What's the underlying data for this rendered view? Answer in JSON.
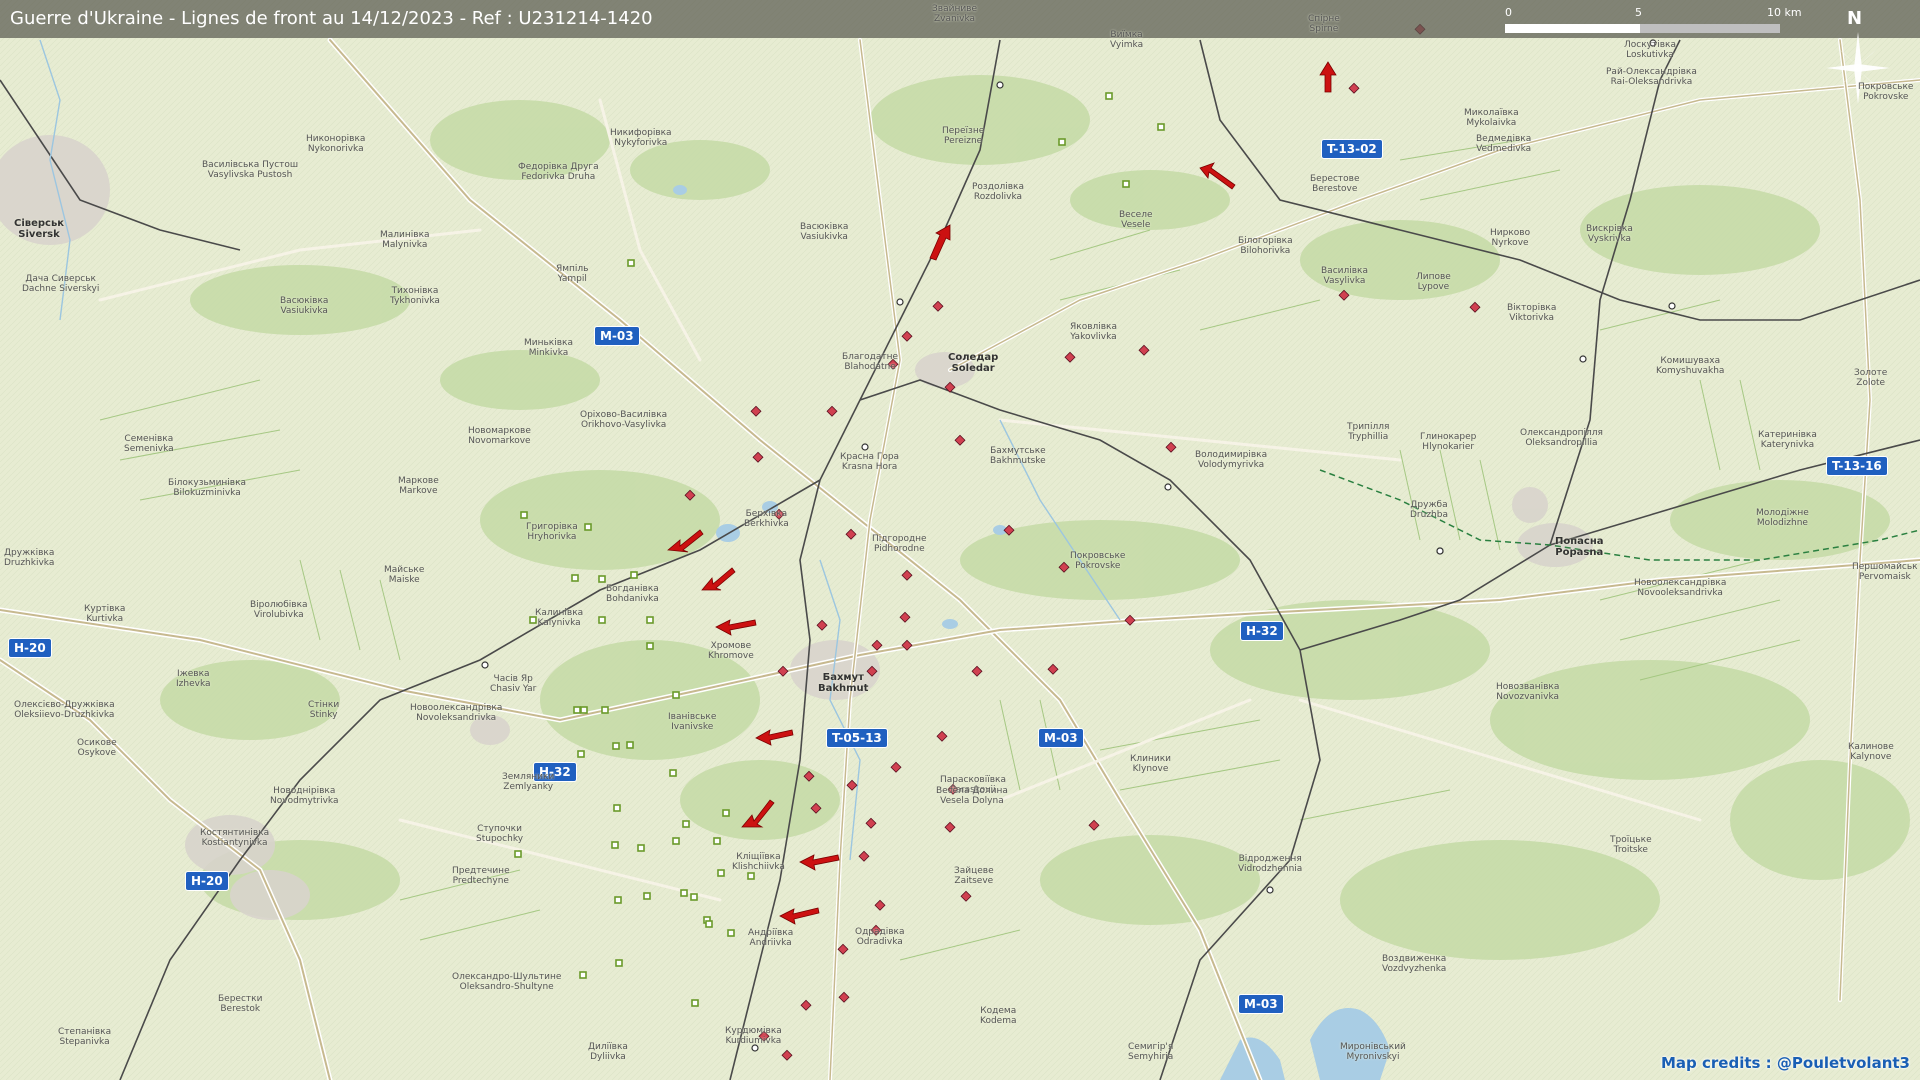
{
  "title": "Guerre d'Ukraine - Lignes de front au 14/12/2023 - Ref : U231214-1420",
  "scale": {
    "labels": [
      "0",
      "5",
      "10 km"
    ]
  },
  "north": {
    "letter": "N",
    "icon": "compass-rose-icon"
  },
  "credits": "Map credits : @Pouletvolant3",
  "colors": {
    "background": "#e7ecd2",
    "road_shield": "#2060c0",
    "attack_arrow": "#cc1111",
    "unit_marker": "#d04050",
    "friendly_marker": "#7aa83a",
    "railway": "#4a4a4a",
    "frontline": "#2a8040"
  },
  "road_shields": [
    {
      "label": "M-03"
    },
    {
      "label": "T-13-02"
    },
    {
      "label": "H-20"
    },
    {
      "label": "H-20"
    },
    {
      "label": "T-05-13"
    },
    {
      "label": "M-03"
    },
    {
      "label": "H-32"
    },
    {
      "label": "H-32"
    },
    {
      "label": "T-13-16"
    },
    {
      "label": "M-03"
    }
  ],
  "places": [
    {
      "ua": "Бахмут",
      "lat": "Bakhmut",
      "major": true
    },
    {
      "ua": "Соледар",
      "lat": "Soledar",
      "major": true
    },
    {
      "ua": "Часів Яр",
      "lat": "Chasiv Yar",
      "major": false
    },
    {
      "ua": "Благодатне",
      "lat": "Blahodatne"
    },
    {
      "ua": "Красна Гора",
      "lat": "Krasna Hora"
    },
    {
      "ua": "Парасковіївка",
      "lat": "Paraskovii"
    },
    {
      "ua": "Яковлівка",
      "lat": "Yakovlivka"
    },
    {
      "ua": "Роздолівка",
      "lat": "Rozdolivka"
    },
    {
      "ua": "Веселе",
      "lat": "Vesele"
    },
    {
      "ua": "Берестове",
      "lat": "Berestove"
    },
    {
      "ua": "Василівка",
      "lat": "Vasylivka"
    },
    {
      "ua": "Липове",
      "lat": "Lypove"
    },
    {
      "ua": "Вікторівка",
      "lat": "Viktorivka"
    },
    {
      "ua": "Бахмутське",
      "lat": "Bakhmutske"
    },
    {
      "ua": "Володимирівка",
      "lat": "Volodymyrivka"
    },
    {
      "ua": "Трипілля",
      "lat": "Tryphillia"
    },
    {
      "ua": "Дружба",
      "lat": "Druzhba"
    },
    {
      "ua": "Покровське",
      "lat": "Pokrovske"
    },
    {
      "ua": "Підгородне",
      "lat": "Pidhorodne"
    },
    {
      "ua": "Берхівка",
      "lat": "Berkhivka"
    },
    {
      "ua": "Хромове",
      "lat": "Khromove"
    },
    {
      "ua": "Богданівка",
      "lat": "Bohdanivka"
    },
    {
      "ua": "Григорівка",
      "lat": "Hryhorivka"
    },
    {
      "ua": "Калинівка",
      "lat": "Kalynivka"
    },
    {
      "ua": "Іванівське",
      "lat": "Ivanivske"
    },
    {
      "ua": "Кліщіївка",
      "lat": "Klishchiivka"
    },
    {
      "ua": "Андріївка",
      "lat": "Andriivka"
    },
    {
      "ua": "Одрадівка",
      "lat": "Odradivka"
    },
    {
      "ua": "Курдюмівка",
      "lat": "Kurdiumivka"
    },
    {
      "ua": "Зайцеве",
      "lat": "Zaitseve"
    },
    {
      "ua": "Весела Долина",
      "lat": "Vesela Dolyna"
    },
    {
      "ua": "Майське",
      "lat": "Maiske"
    },
    {
      "ua": "Куртівка",
      "lat": "Kurtivka"
    },
    {
      "ua": "Віролюбівка",
      "lat": "Virolubivka"
    },
    {
      "ua": "Іжевка",
      "lat": "Izhevka"
    },
    {
      "ua": "Олексієво-Дружківка",
      "lat": "Oleksiievo-Druzhkivka"
    },
    {
      "ua": "Осикове",
      "lat": "Osykove"
    },
    {
      "ua": "Стінки",
      "lat": "Stinky"
    },
    {
      "ua": "Новоолександрівка",
      "lat": "Novoleksandrivka"
    },
    {
      "ua": "Костянтинівка",
      "lat": "Kostiantynivka",
      "major": true
    },
    {
      "ua": "Ступочки",
      "lat": "Stupochky"
    },
    {
      "ua": "Предтечине",
      "lat": "Predtechyne"
    },
    {
      "ua": "Земляники",
      "lat": "Zemlyanky"
    },
    {
      "ua": "Новоднірівка",
      "lat": "Novodmytrivka"
    },
    {
      "ua": "Берестки",
      "lat": "Berestok"
    },
    {
      "ua": "Олександро-Шультине",
      "lat": "Oleksandro-Shultyne"
    },
    {
      "ua": "Степанівка",
      "lat": "Stepanivka"
    },
    {
      "ua": "Диліївка",
      "lat": "Dyliivka"
    },
    {
      "ua": "Клиники",
      "lat": "Klynove"
    },
    {
      "ua": "Відродження",
      "lat": "Vidrodzhennia"
    },
    {
      "ua": "Кодема",
      "lat": "Kodema"
    },
    {
      "ua": "Семигір'я",
      "lat": "Semyhiria"
    },
    {
      "ua": "Миронівський",
      "lat": "Myronivskyi"
    },
    {
      "ua": "Воздвиженка",
      "lat": "Vozdvyzhenka"
    },
    {
      "ua": "Троїцьке",
      "lat": "Troitske"
    },
    {
      "ua": "Калинове",
      "lat": "Kalynove"
    },
    {
      "ua": "Новозванівка",
      "lat": "Novozvanivka"
    },
    {
      "ua": "Попасна",
      "lat": "Popasna",
      "major": true
    },
    {
      "ua": "Новоолександрівка",
      "lat": "Novooleksandrivka"
    },
    {
      "ua": "Олександропілля",
      "lat": "Oleksandropillia"
    },
    {
      "ua": "Глинокарер",
      "lat": "Hlynokarier"
    },
    {
      "ua": "Катеринівка",
      "lat": "Katerynivka"
    },
    {
      "ua": "Молодіжне",
      "lat": "Molodizhne"
    },
    {
      "ua": "Першомайськ",
      "lat": "Pervomaisk"
    },
    {
      "ua": "Комишуваха",
      "lat": "Komyshuvakha"
    },
    {
      "ua": "Золоте",
      "lat": "Zolote"
    },
    {
      "ua": "Вискрівка",
      "lat": "Vyskrivka"
    },
    {
      "ua": "Нирково",
      "lat": "Nyrkove"
    },
    {
      "ua": "Миколаївка",
      "lat": "Mykolaivka"
    },
    {
      "ua": "Лоскутівка",
      "lat": "Loskutivka"
    },
    {
      "ua": "Рай-Олександрівка",
      "lat": "Rai-Oleksandrivka"
    },
    {
      "ua": "Білогорівка",
      "lat": "Bilohorivka"
    },
    {
      "ua": "Спірне",
      "lat": "Spirne"
    },
    {
      "ua": "Виїмка",
      "lat": "Vyimka"
    },
    {
      "ua": "Переїзне",
      "lat": "Pereizne"
    },
    {
      "ua": "Звайниве",
      "lat": "Zvanivka"
    },
    {
      "ua": "Оріхово-Василівка",
      "lat": "Orikhovo-Vasylivka"
    },
    {
      "ua": "Новомаркове",
      "lat": "Novomarkove"
    },
    {
      "ua": "Маркове",
      "lat": "Markove"
    },
    {
      "ua": "Семенівка",
      "lat": "Semenivka"
    },
    {
      "ua": "Білокузьминівка",
      "lat": "Bilokuzminivka"
    },
    {
      "ua": "Дружківка",
      "lat": "Druzhkivka"
    },
    {
      "ua": "Васюківка",
      "lat": "Vasiukivka"
    },
    {
      "ua": "Миньківка",
      "lat": "Minkivka"
    },
    {
      "ua": "Федорівка Друга",
      "lat": "Fedorivka Druha"
    },
    {
      "ua": "Никифорівка",
      "lat": "Nykyforivka"
    },
    {
      "ua": "Никонорівка",
      "lat": "Nykonorivka"
    },
    {
      "ua": "Василівська Пустош",
      "lat": "Vasylivska Pustosh"
    },
    {
      "ua": "Сіверськ",
      "lat": "Siversk",
      "major": true
    },
    {
      "ua": "Малинівка",
      "lat": "Malynivka"
    },
    {
      "ua": "Тихонівка",
      "lat": "Tykhonivka"
    },
    {
      "ua": "Дача Сиверськ",
      "lat": "Dachne Siverskyi"
    },
    {
      "ua": "Ямпіль",
      "lat": "Yampil"
    },
    {
      "ua": "Ведмедівка",
      "lat": "Vedmedivka"
    },
    {
      "ua": "Васюківка",
      "lat": "Vasiukivka"
    },
    {
      "ua": "Покровське",
      "lat": "Pokrovske"
    }
  ]
}
